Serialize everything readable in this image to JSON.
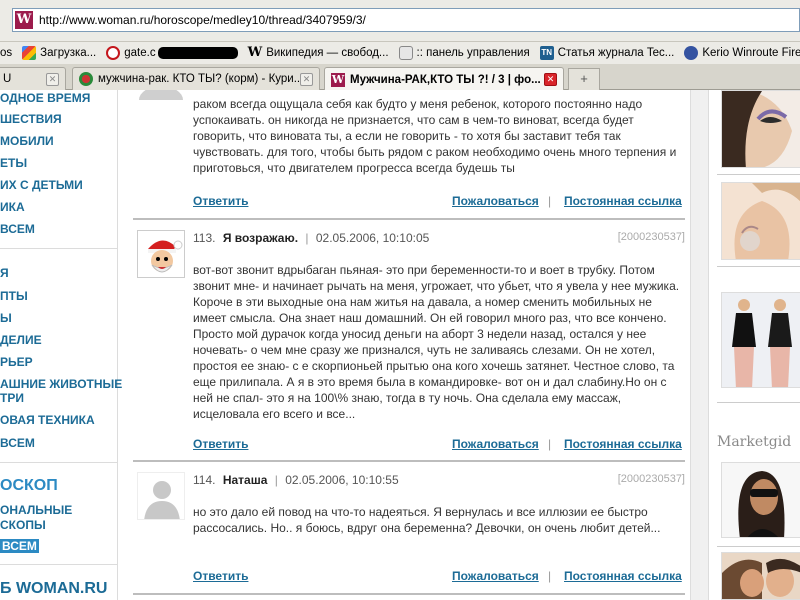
{
  "browser": {
    "url": "http://www.woman.ru/horoscope/medley10/thread/3407959/3/",
    "bookmarks": [
      {
        "label": "os",
        "icon": "page-icon"
      },
      {
        "label": "Загрузка...",
        "icon": "google-icon"
      },
      {
        "label": "gate.c",
        "icon": "gate-icon"
      },
      {
        "label": "Википедия — свобод...",
        "icon": "wikipedia-icon"
      },
      {
        "label": ":: панель управления",
        "icon": "panel-icon"
      },
      {
        "label": "Статья журнала Tec...",
        "icon": "tn-icon"
      },
      {
        "label": "Kerio Winroute Firewa",
        "icon": "kerio-icon"
      }
    ],
    "tabs": [
      {
        "label": "U",
        "active": false
      },
      {
        "label": "мужчина-рак. КТО ТЫ? (корм) - Кури...",
        "active": false
      },
      {
        "label": "Мужчина-РАК,КТО ТЫ ?! / 3 | фо...",
        "active": true
      }
    ],
    "new_tab": "+"
  },
  "leftnav": {
    "group1": [
      "ОДНОЕ ВРЕМЯ",
      "ШЕСТВИЯ",
      "МОБИЛИ",
      "ЕТЫ",
      "ИХ С ДЕТЬМИ",
      "ИКА",
      "ВСЕМ"
    ],
    "group2": [
      "Я",
      "ПТЫ",
      "Ы",
      "ДЕЛИЕ",
      "РЬЕР",
      "АШНИЕ ЖИВОТНЫЕ",
      "ТРИ",
      "ОВАЯ ТЕХНИКА",
      "ВСЕМ"
    ],
    "horoscope_head": "ОСКОП",
    "horoscope_items": [
      "ОНАЛЬНЫЕ",
      "СКОПЫ"
    ],
    "horoscope_all": "ВСЕМ",
    "brand": "Б WOMAN.RU"
  },
  "comments": [
    {
      "text": "раком всегда ощущала себя как будто у меня ребенок, которого постоянно надо успокаивать. он никогда не признается, что сам в чем-то виноват, всегда будет говорить, что виновата ты, а если не говорить - то хотя бы заставит тебя так чувствовать. для того, чтобы быть рядом с раком необходимо очень много терпения и приготовься, что двигателем прогресса всегда будешь ты"
    },
    {
      "number": "113.",
      "author": "Я возражаю.",
      "date": "02.05.2006, 10:10:05",
      "id": "[2000230537]",
      "avatar": "santa-avatar",
      "text": "вот-вот звонит вдрыбаган пьяная- это при беременности-то и воет в трубку. Потом звонит мне- и начинает рычать на меня, угрожает, что убьет, что я увела у нее мужика. Короче в эти выходные она нам житья на давала, а номер сменить мобильных не имеет смысла. Она знает наш домашний. Он ей говорил много раз, что все кончено. Просто мой дурачок когда уносид деньги на аборт 3 недели назад, остался у нее ночевать- о чем мне сразу же признался, чуть не заливаясь слезами. Он не хотел, простоя ее знаю- с е скорпионьей прытью она кого хочешь затянет. Честное слово, та еще прилипала. А я в это время была в командировке- вот он и дал слабину.Но он с ней не спал- это я на 100\\% знаю, тогда в ту ночь. Она сделала ему массаж, исцеловала его всего и все..."
    },
    {
      "number": "114.",
      "author": "Наташа",
      "date": "02.05.2006, 10:10:55",
      "id": "[2000230537]",
      "avatar": "default-user-avatar",
      "text": "но это дало ей повод на что-то надеяться. Я вернулась и все иллюзии ее быстро рассосались. Но.. я боюсь, вдруг она беременна? Девочки, он очень любит детей..."
    }
  ],
  "actions": {
    "reply": "Ответить",
    "report": "Пожаловаться",
    "separator": "|",
    "permalink": "Постоянная ссылка"
  },
  "right": {
    "marketgid": "Marketgid"
  },
  "colors": {
    "link": "#1c6b96",
    "accent": "#2c8ac3",
    "brand": "#9c1b4c"
  }
}
